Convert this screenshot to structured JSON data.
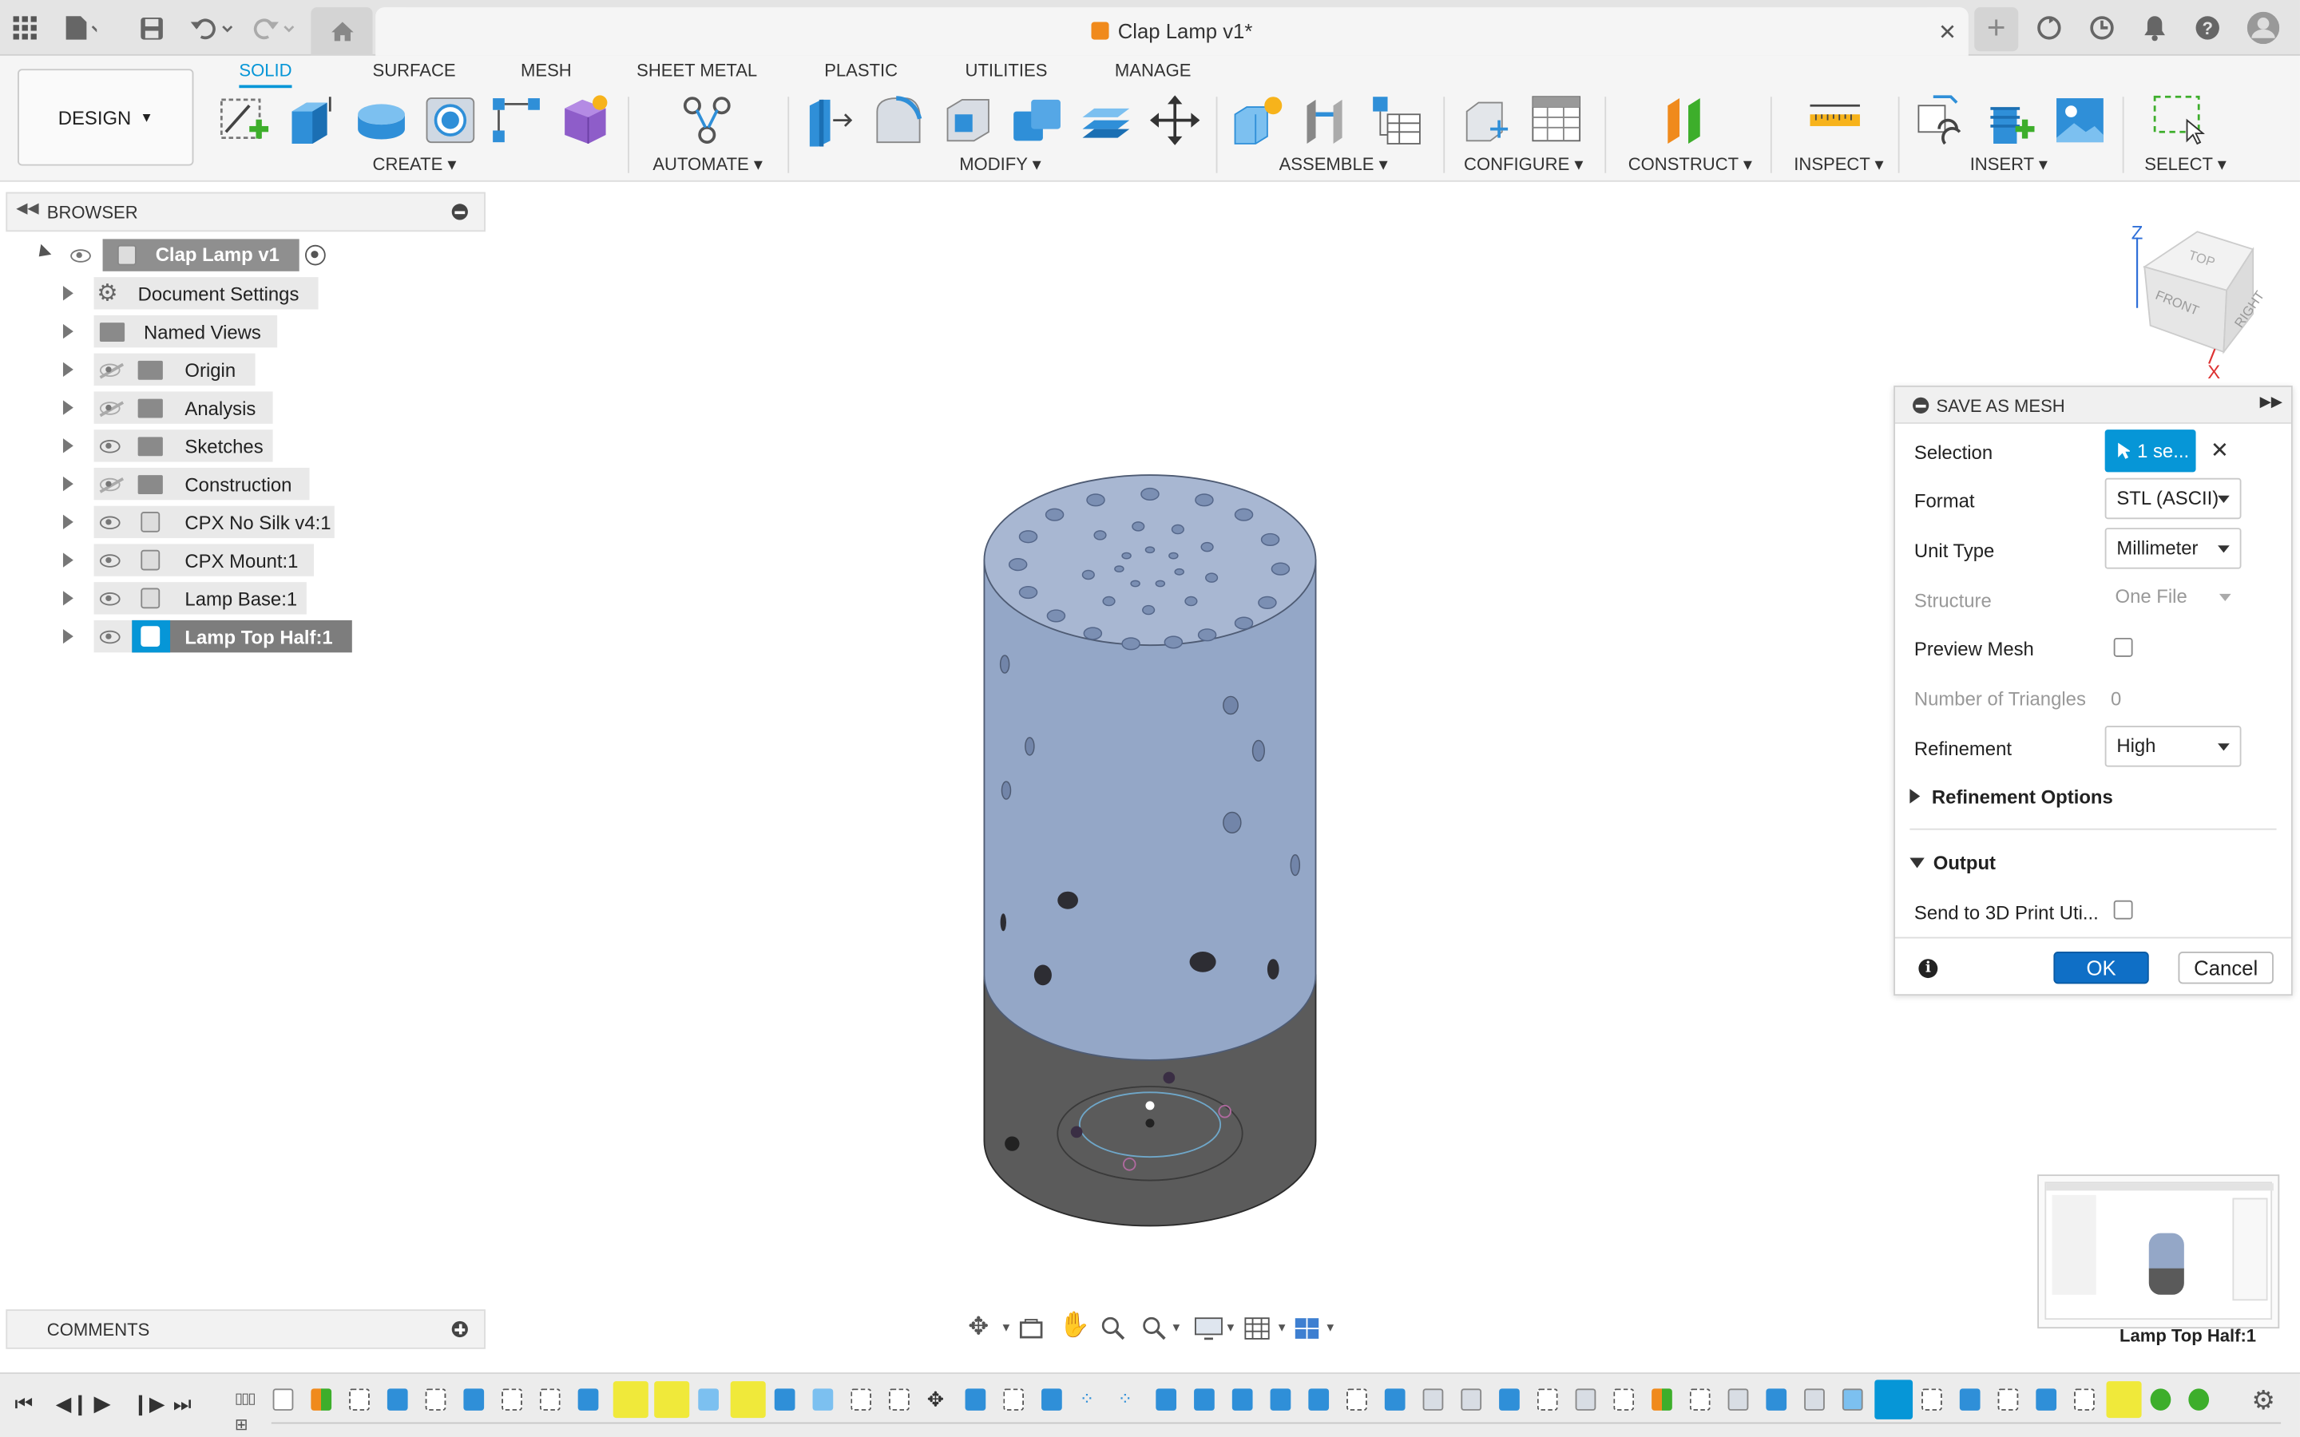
{
  "document": {
    "title": "Clap Lamp v1*"
  },
  "workspace": {
    "label": "DESIGN"
  },
  "tabs": [
    "SOLID",
    "SURFACE",
    "MESH",
    "SHEET METAL",
    "PLASTIC",
    "UTILITIES",
    "MANAGE"
  ],
  "active_tab": "SOLID",
  "toolbar_groups": [
    "CREATE",
    "AUTOMATE",
    "MODIFY",
    "ASSEMBLE",
    "CONFIGURE",
    "CONSTRUCT",
    "INSPECT",
    "INSERT",
    "SELECT"
  ],
  "browser": {
    "title": "BROWSER",
    "root": "Clap Lamp v1",
    "items": [
      "Document Settings",
      "Named Views",
      "Origin",
      "Analysis",
      "Sketches",
      "Construction",
      "CPX No Silk v4:1",
      "CPX Mount:1",
      "Lamp Base:1",
      "Lamp Top Half:1"
    ]
  },
  "comments": {
    "title": "COMMENTS"
  },
  "save_as_mesh": {
    "title": "SAVE AS MESH",
    "selection_label": "Selection",
    "selection_value": "1 se...",
    "format_label": "Format",
    "format_value": "STL (ASCII)",
    "unit_label": "Unit Type",
    "unit_value": "Millimeter",
    "structure_label": "Structure",
    "structure_value": "One File",
    "preview_label": "Preview Mesh",
    "triangles_label": "Number of Triangles",
    "triangles_value": "0",
    "refinement_label": "Refinement",
    "refinement_value": "High",
    "refinement_options_label": "Refinement Options",
    "output_label": "Output",
    "send_label": "Send to 3D Print Uti...",
    "ok_label": "OK",
    "cancel_label": "Cancel"
  },
  "viewcube": {
    "top": "TOP",
    "front": "FRONT",
    "right": "RIGHT",
    "z": "Z",
    "x": "X"
  },
  "thumbnail_caption": "Lamp Top Half:1",
  "colors": {
    "accent": "#0696d7",
    "lamp_top": "#94a7c7",
    "lamp_base": "#5a5a5a"
  }
}
